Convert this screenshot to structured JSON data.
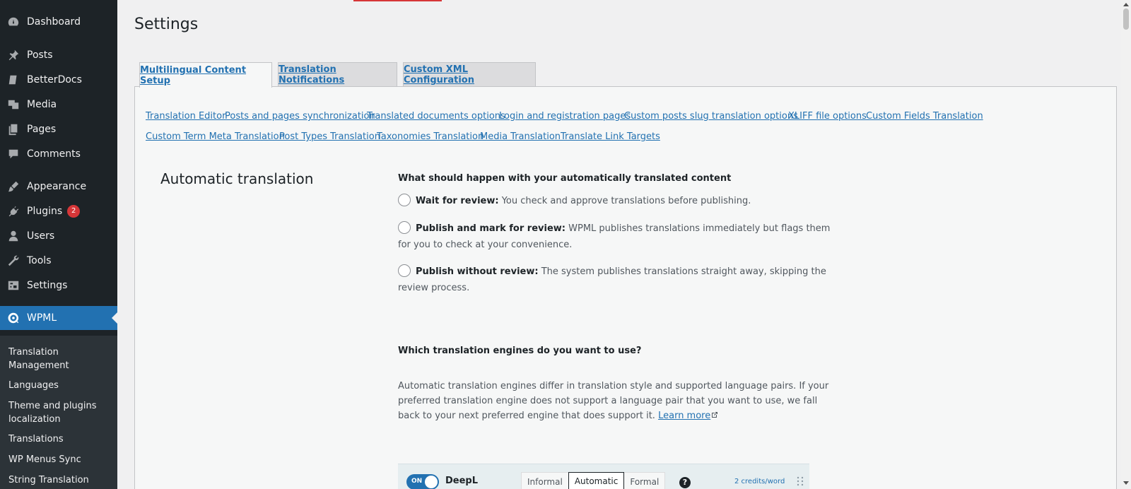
{
  "sidebar": {
    "items": [
      {
        "label": "Dashboard",
        "icon": "dashboard-icon"
      },
      {
        "label": "Posts",
        "icon": "pin-icon"
      },
      {
        "label": "BetterDocs",
        "icon": "docs-icon"
      },
      {
        "label": "Media",
        "icon": "media-icon"
      },
      {
        "label": "Pages",
        "icon": "pages-icon"
      },
      {
        "label": "Comments",
        "icon": "comments-icon"
      },
      {
        "label": "Appearance",
        "icon": "brush-icon"
      },
      {
        "label": "Plugins",
        "icon": "plug-icon",
        "badge": "2"
      },
      {
        "label": "Users",
        "icon": "users-icon"
      },
      {
        "label": "Tools",
        "icon": "wrench-icon"
      },
      {
        "label": "Settings",
        "icon": "settings-icon"
      },
      {
        "label": "WPML",
        "icon": "wpml-icon"
      }
    ],
    "submenu": [
      "Translation Management",
      "Languages",
      "Theme and plugins localization",
      "Translations",
      "WP Menus Sync",
      "String Translation"
    ]
  },
  "page": {
    "title": "Settings",
    "tabs": [
      "Multilingual Content Setup",
      "Translation Notifications",
      "Custom XML Configuration"
    ],
    "sublinks_row1": [
      "Translation Editor",
      "Posts and pages synchronization",
      "Translated documents options",
      "Login and registration pages",
      "Custom posts slug translation options",
      "XLIFF file options",
      "Custom Fields Translation"
    ],
    "sublinks_row2": [
      "Custom Term Meta Translation",
      "Post Types Translation",
      "Taxonomies Translation",
      "Media Translation",
      "Translate Link Targets"
    ]
  },
  "automatic": {
    "section_title": "Automatic translation",
    "question1": "What should happen with your automatically translated content",
    "options": [
      {
        "label": "Wait for review:",
        "text": "You check and approve translations before publishing."
      },
      {
        "label": "Publish and mark for review:",
        "text": "WPML publishes translations immediately but flags them for you to check at your convenience."
      },
      {
        "label": "Publish without review:",
        "text": "The system publishes translations straight away, skipping the review process."
      }
    ],
    "question2": "Which translation engines do you want to use?",
    "engines_desc": "Automatic translation engines differ in translation style and supported language pairs. If your preferred translation engine does not support a language pair that you want to use, we fall back to your next preferred engine that does support it.",
    "learn_more": "Learn more",
    "engine": {
      "toggle": "ON",
      "name": "DeepL",
      "styles": [
        "Informal",
        "Automatic",
        "Formal"
      ],
      "selected_style": "Automatic",
      "help": "?",
      "credits": "2 credits/word"
    }
  },
  "colors": {
    "accent": "#2271b1",
    "sidebar_bg": "#1d2327",
    "badge": "#d63638"
  }
}
